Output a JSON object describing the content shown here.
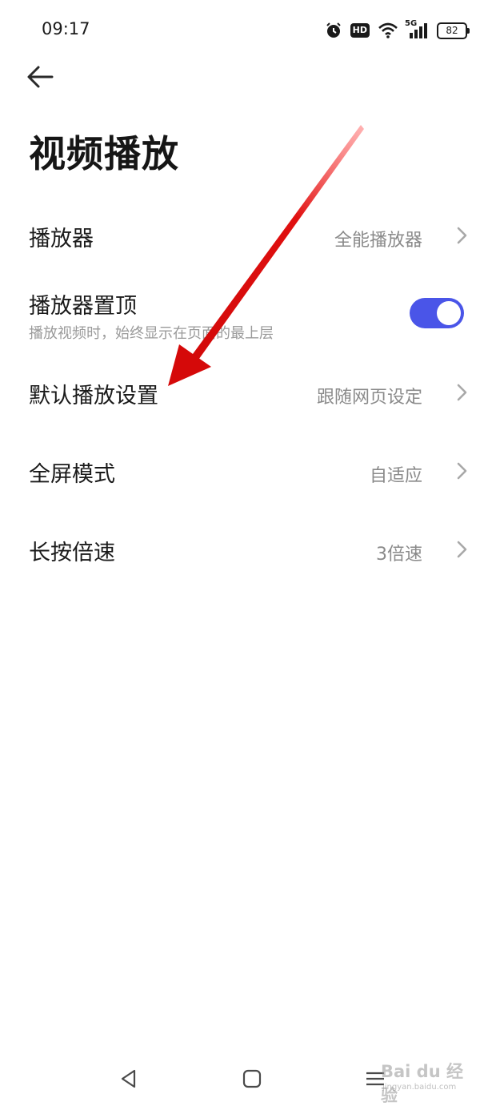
{
  "status_bar": {
    "time": "09:17",
    "hd_badge": "HD",
    "network": "5G",
    "battery": "82",
    "icons": [
      "alarm-icon",
      "hd-icon",
      "wifi-icon",
      "signal-icon",
      "battery-icon"
    ]
  },
  "header": {
    "back_icon": "back-arrow-icon",
    "title": "视频播放"
  },
  "settings": {
    "player": {
      "label": "播放器",
      "value": "全能播放器"
    },
    "pin_player": {
      "label": "播放器置顶",
      "description": "播放视频时，始终显示在页面的最上层",
      "enabled": true
    },
    "default_play": {
      "label": "默认播放设置",
      "value": "跟随网页设定"
    },
    "fullscreen_mode": {
      "label": "全屏模式",
      "value": "自适应"
    },
    "long_press_speed": {
      "label": "长按倍速",
      "value": "3倍速"
    }
  },
  "nav_bar": {
    "icons": [
      "back-triangle-icon",
      "home-square-icon",
      "menu-lines-icon"
    ]
  },
  "watermark": {
    "brand": "Bai du 经验",
    "url": "jingyan.baidu.com"
  },
  "annotation": {
    "arrow_color": "#e01010",
    "icon": "red-arrow-annotation"
  },
  "colors": {
    "accent": "#4a55e8",
    "text_primary": "#1a1a1a",
    "text_secondary": "#8a8a8a"
  }
}
